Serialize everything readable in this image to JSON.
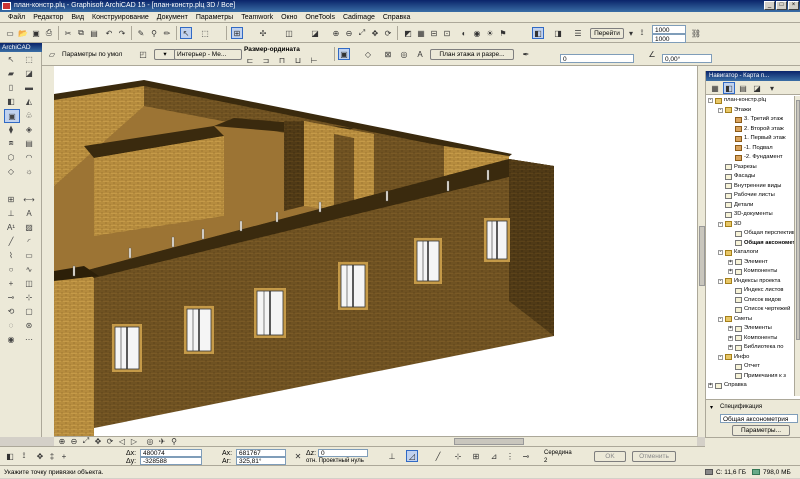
{
  "window": {
    "title": "план-констр.рlц - Graphisoft ArchiCAD 15 - [план-констр.рlц 3D / Все]",
    "btn_min": "_",
    "btn_max": "□",
    "btn_close": "×"
  },
  "menu": [
    "Файл",
    "Редактор",
    "Вид",
    "Конструирование",
    "Документ",
    "Параметры",
    "Teamwork",
    "Окно",
    "OneTools",
    "Cadimage",
    "Справка"
  ],
  "toolbar1": {
    "goto_label": "Перейти",
    "field_1000_a": "1000",
    "field_1000_b": "1000"
  },
  "toolbar2": {
    "default_params": "Параметры по умолч.",
    "interior_label": "Интерьер - Ме...",
    "dimension_label": "Размер-ордината",
    "plan_button": "План этажа и разре...",
    "field_zero": "0",
    "angle_value": "0,00°"
  },
  "toolbox": {
    "title": "ArchiCAD"
  },
  "navigator": {
    "title": "Навигатор - Карта п...",
    "items": [
      {
        "label": "план-констр.рlц",
        "indent": 0,
        "icon": "folder",
        "exp": "-"
      },
      {
        "label": "Этажи",
        "indent": 1,
        "icon": "folder",
        "exp": "-"
      },
      {
        "label": "3. Третий этаж",
        "indent": 2,
        "icon": "story"
      },
      {
        "label": "2. Второй этаж",
        "indent": 2,
        "icon": "story"
      },
      {
        "label": "1. Первый этаж",
        "indent": 2,
        "icon": "story"
      },
      {
        "label": "-1. Подвал",
        "indent": 2,
        "icon": "story"
      },
      {
        "label": "-2. Фундамент",
        "indent": 2,
        "icon": "story"
      },
      {
        "label": "Разрезы",
        "indent": 1,
        "icon": "doc"
      },
      {
        "label": "Фасады",
        "indent": 1,
        "icon": "doc"
      },
      {
        "label": "Внутренние виды",
        "indent": 1,
        "icon": "doc"
      },
      {
        "label": "Рабочие листы",
        "indent": 1,
        "icon": "doc"
      },
      {
        "label": "Детали",
        "indent": 1,
        "icon": "doc"
      },
      {
        "label": "3D-документы",
        "indent": 1,
        "icon": "doc"
      },
      {
        "label": "3D",
        "indent": 1,
        "icon": "folder",
        "exp": "-"
      },
      {
        "label": "Общая перспектива",
        "indent": 2,
        "icon": "doc"
      },
      {
        "label": "Общая аксонометрия",
        "indent": 2,
        "icon": "doc",
        "bold": true
      },
      {
        "label": "Каталоги",
        "indent": 1,
        "icon": "folder",
        "exp": "-"
      },
      {
        "label": "Элемент",
        "indent": 2,
        "icon": "doc",
        "exp": "+"
      },
      {
        "label": "Компоненты",
        "indent": 2,
        "icon": "doc",
        "exp": "+"
      },
      {
        "label": "Индексы проекта",
        "indent": 1,
        "icon": "folder",
        "exp": "-"
      },
      {
        "label": "Индекс листов",
        "indent": 2,
        "icon": "doc"
      },
      {
        "label": "Список видов",
        "indent": 2,
        "icon": "doc"
      },
      {
        "label": "Список чертежей",
        "indent": 2,
        "icon": "doc"
      },
      {
        "label": "Сметы",
        "indent": 1,
        "icon": "folder",
        "exp": "-"
      },
      {
        "label": "Элементы",
        "indent": 2,
        "icon": "doc",
        "exp": "+"
      },
      {
        "label": "Компоненты",
        "indent": 2,
        "icon": "doc",
        "exp": "+"
      },
      {
        "label": "Библиотека по",
        "indent": 2,
        "icon": "doc",
        "exp": "+"
      },
      {
        "label": "Инфо",
        "indent": 1,
        "icon": "folder",
        "exp": "-"
      },
      {
        "label": "Отчет",
        "indent": 2,
        "icon": "doc"
      },
      {
        "label": "Примечания к з",
        "indent": 2,
        "icon": "doc"
      },
      {
        "label": "Справка",
        "indent": 0,
        "icon": "doc",
        "exp": "+"
      }
    ],
    "spec_label": "Спецификация",
    "spec_value": "Общая аксонометрия",
    "params_button": "Параметры..."
  },
  "coords": {
    "dx_label": "Δx:",
    "dx_value": "480074",
    "dy_label": "Δy:",
    "dy_value": "-328588",
    "ax_label": "Ax:",
    "ax_value": "681767",
    "ar_label": "Ar:",
    "ar_value": "325,81°",
    "z_label": "Δz:",
    "z_value": "0",
    "z_ref": "отн. Проектный нуль",
    "snap_label": "Середина",
    "snap_value": "2",
    "ok_button": "OK",
    "cancel_button": "Отменить"
  },
  "status": {
    "hint": "Укажите точку привязки объекта.",
    "disk_label": "С: 11,6 ГБ",
    "mem_label": "798,0 МБ"
  },
  "colors": {
    "brick": "#7a5a26",
    "brick_dark": "#4d3814",
    "brick_light": "#d2a856",
    "title_blue": "#0a246a"
  }
}
